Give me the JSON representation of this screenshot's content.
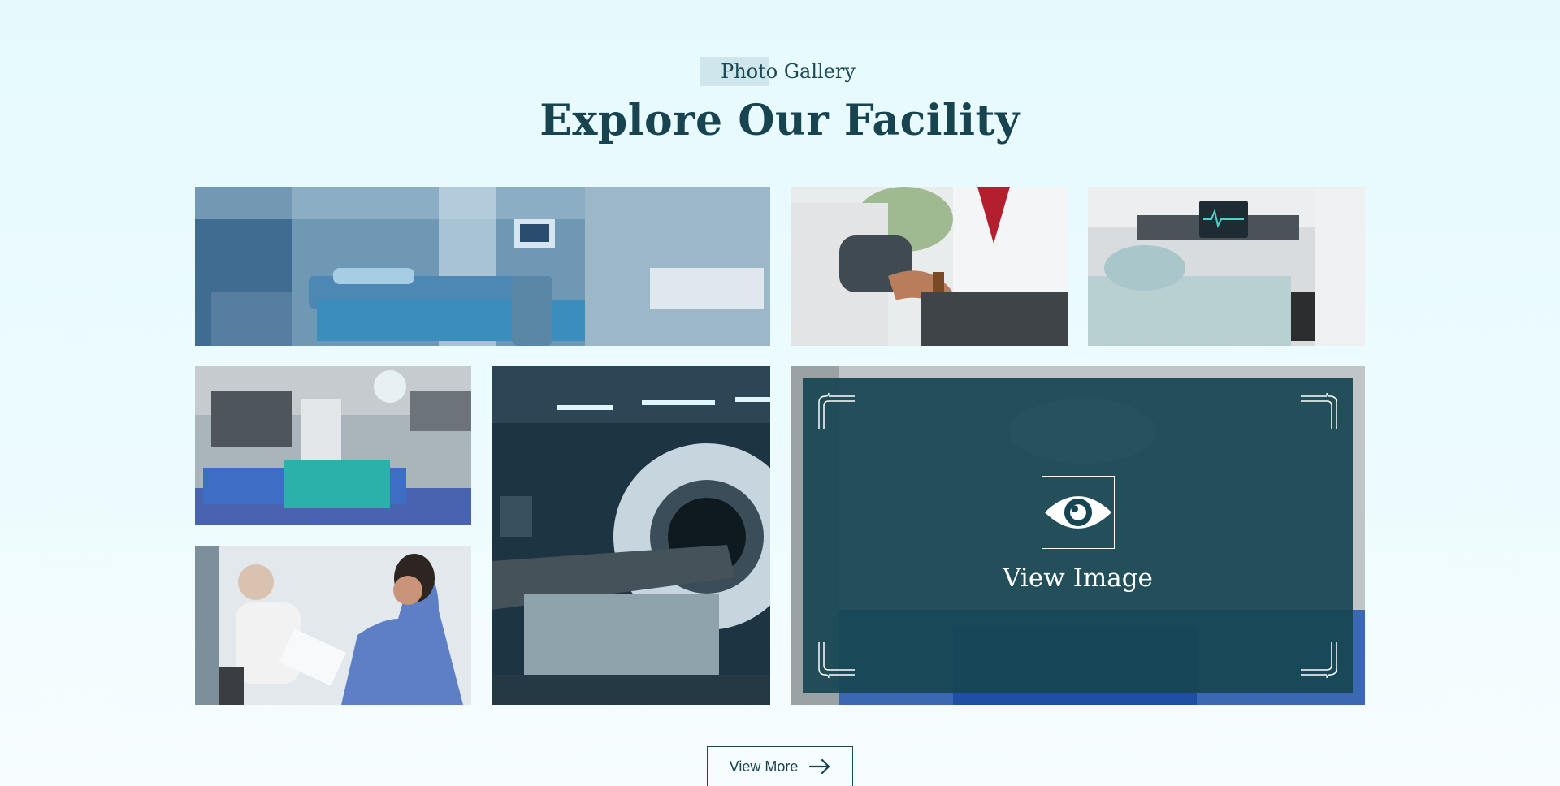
{
  "section": {
    "eyebrow": "Photo Gallery",
    "title": "Explore Our Facility"
  },
  "gallery": {
    "images": [
      {
        "subject": "hospital-ward-beds"
      },
      {
        "subject": "doctor-blood-pressure"
      },
      {
        "subject": "patient-bed-monitor"
      },
      {
        "subject": "operating-room"
      },
      {
        "subject": "mri-scanner"
      },
      {
        "subject": "nurse-with-patient"
      },
      {
        "subject": "surgery-team"
      }
    ],
    "overlay": {
      "label": "View Image",
      "icon": "eye-icon"
    }
  },
  "actions": {
    "view_more_label": "View More",
    "view_more_icon": "arrow-right-icon"
  },
  "colors": {
    "background": "#e6fafe",
    "primary": "#17444f",
    "overlay": "#174652"
  }
}
